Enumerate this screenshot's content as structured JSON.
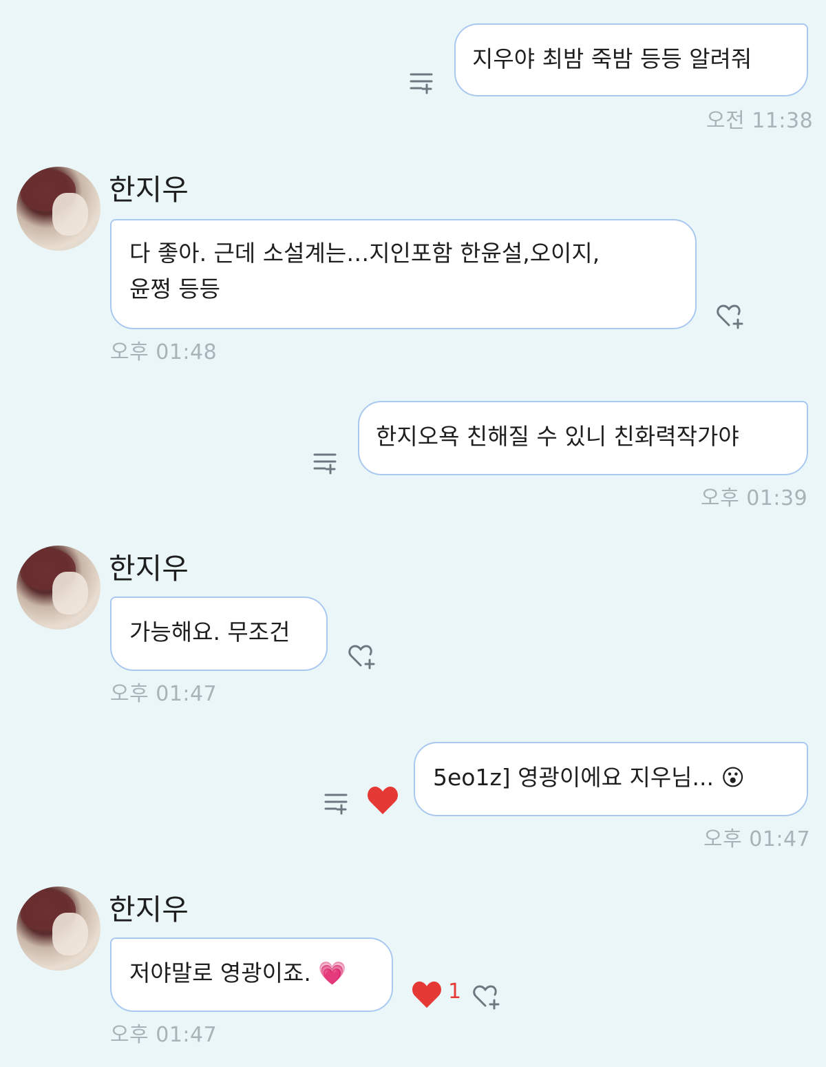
{
  "contact_name": "한지우",
  "messages": [
    {
      "side": "right",
      "text": "지우야 최밤 죽밤 등등 알려줘",
      "time": "오전 11:38"
    },
    {
      "side": "left",
      "lines": [
        "다 좋아. 근데 소설계는…지인포함 한윤설,오이지,",
        "윤쩡 등등"
      ],
      "time": "오후 01:48"
    },
    {
      "side": "right",
      "text": "한지오욕 친해질 수 있니 친화력작가야",
      "time": "오후 01:39"
    },
    {
      "side": "left",
      "text": "가능해요. 무조건",
      "time": "오후 01:47"
    },
    {
      "side": "right",
      "text": "5eo1z] 영광이에요 지우님... ",
      "emoji": "😮",
      "time": "오후 01:47"
    },
    {
      "side": "left",
      "text": "저야말로 영광이죠. ",
      "emoji": "💗",
      "time": "오후 01:47",
      "reaction_count": "1"
    }
  ],
  "icons": {
    "reply": "reply-list-icon",
    "react": "heart-add-icon",
    "heart": "heart-icon"
  },
  "colors": {
    "background": "#eaf6f8",
    "bubble_border": "#a8c8ef",
    "heart": "#e53935",
    "time": "#a9b2b8"
  }
}
